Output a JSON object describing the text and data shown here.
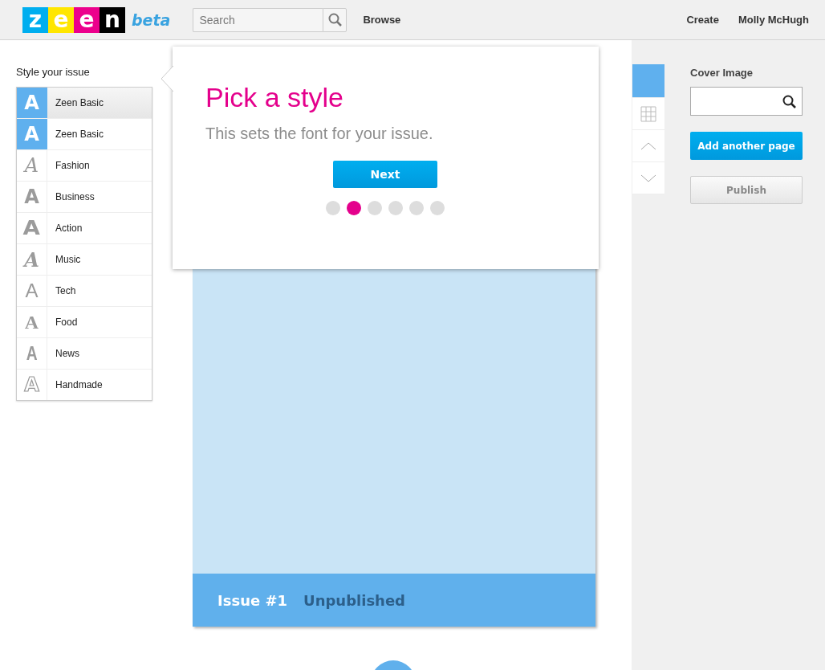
{
  "header": {
    "logo_letters": [
      {
        "char": "z",
        "color": "#00aeef"
      },
      {
        "char": "e",
        "color": "#ffe600"
      },
      {
        "char": "e",
        "color": "#ec008c"
      },
      {
        "char": "n",
        "color": "#000000"
      }
    ],
    "logo_tag": "beta",
    "search": {
      "placeholder": "Search"
    },
    "nav": [
      "Browse"
    ],
    "user_nav": [
      "Create",
      "Molly McHugh"
    ]
  },
  "style_panel": {
    "title": "Style your issue",
    "items": [
      {
        "glyph": "A",
        "kind": "basic",
        "label": "Zeen Basic",
        "selected": true,
        "highlighted": true
      },
      {
        "glyph": "A",
        "kind": "basic",
        "label": "Zeen Basic",
        "selected": true,
        "highlighted": false
      },
      {
        "glyph": "A",
        "kind": "script",
        "label": "Fashion",
        "selected": false,
        "highlighted": false
      },
      {
        "glyph": "A",
        "kind": "sans",
        "label": "Business",
        "selected": false,
        "highlighted": false
      },
      {
        "glyph": "A",
        "kind": "heavy",
        "label": "Action",
        "selected": false,
        "highlighted": false
      },
      {
        "glyph": "A",
        "kind": "italic",
        "label": "Music",
        "selected": false,
        "highlighted": false
      },
      {
        "glyph": "A",
        "kind": "light",
        "label": "Tech",
        "selected": false,
        "highlighted": false
      },
      {
        "glyph": "A",
        "kind": "serif",
        "label": "Food",
        "selected": false,
        "highlighted": false
      },
      {
        "glyph": "A",
        "kind": "condensed",
        "label": "News",
        "selected": false,
        "highlighted": false
      },
      {
        "glyph": "A",
        "kind": "outline",
        "label": "Handmade",
        "selected": false,
        "highlighted": false
      }
    ]
  },
  "popover": {
    "title": "Pick a style",
    "text": "This sets the font for your issue.",
    "button": "Next",
    "steps": [
      {
        "selected": false
      },
      {
        "selected": true
      },
      {
        "selected": false
      },
      {
        "selected": false
      },
      {
        "selected": false
      },
      {
        "selected": false
      }
    ]
  },
  "issue": {
    "title": "Issue #1",
    "status": "Unpublished"
  },
  "tools": [
    {
      "kind": "color",
      "selected": true
    },
    {
      "kind": "grid",
      "selected": false
    },
    {
      "kind": "up",
      "selected": false
    },
    {
      "kind": "down",
      "selected": false
    }
  ],
  "sidebar": {
    "cover_label": "Cover Image",
    "add_button": "Add another page",
    "publish_button": "Publish",
    "publish_disabled": true
  }
}
